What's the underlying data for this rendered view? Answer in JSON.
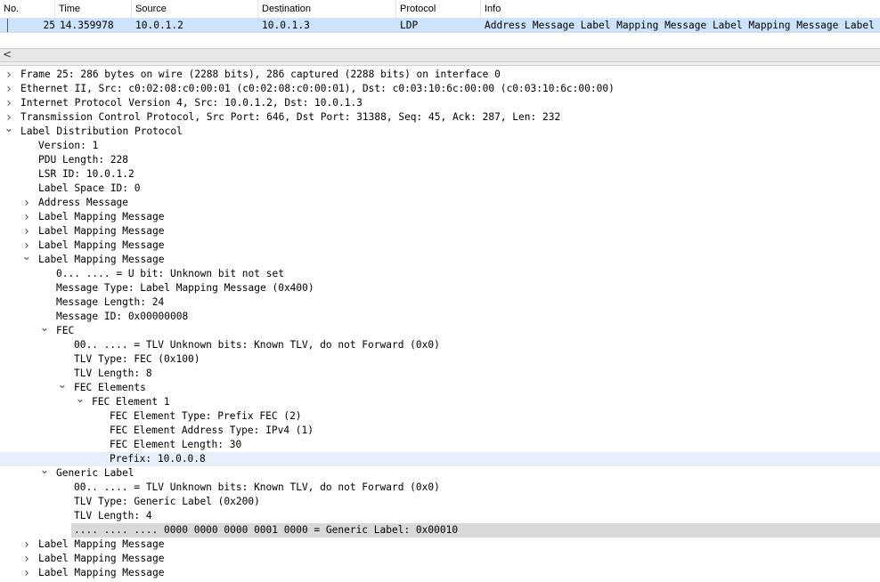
{
  "packet_list": {
    "headers": [
      "No.",
      "Time",
      "Source",
      "Destination",
      "Protocol",
      "Info"
    ],
    "row": {
      "no": "25",
      "time": "14.359978",
      "source": "10.0.1.2",
      "destination": "10.0.1.3",
      "protocol": "LDP",
      "info": "Address Message Label Mapping Message Label Mapping Message Label Mapping Message Label Mapping Message"
    }
  },
  "scroll": {
    "left_arrow": "<"
  },
  "tree": [
    {
      "text": "Frame 25: 286 bytes on wire (2288 bits), 286 captured (2288 bits) on interface 0",
      "toggle": "collapsed"
    },
    {
      "text": "Ethernet II, Src: c0:02:08:c0:00:01 (c0:02:08:c0:00:01), Dst: c0:03:10:6c:00:00 (c0:03:10:6c:00:00)",
      "toggle": "collapsed"
    },
    {
      "text": "Internet Protocol Version 4, Src: 10.0.1.2, Dst: 10.0.1.3",
      "toggle": "collapsed"
    },
    {
      "text": "Transmission Control Protocol, Src Port: 646, Dst Port: 31388, Seq: 45, Ack: 287, Len: 232",
      "toggle": "collapsed"
    },
    {
      "text": "Label Distribution Protocol",
      "toggle": "expanded"
    },
    {
      "text": "Version: 1",
      "toggle": "none"
    },
    {
      "text": "PDU Length: 228",
      "toggle": "none"
    },
    {
      "text": "LSR ID: 10.0.1.2",
      "toggle": "none"
    },
    {
      "text": "Label Space ID: 0",
      "toggle": "none"
    },
    {
      "text": "Address Message",
      "toggle": "collapsed"
    },
    {
      "text": "Label Mapping Message",
      "toggle": "collapsed"
    },
    {
      "text": "Label Mapping Message",
      "toggle": "collapsed"
    },
    {
      "text": "Label Mapping Message",
      "toggle": "collapsed"
    },
    {
      "text": "Label Mapping Message",
      "toggle": "expanded"
    },
    {
      "text": "0... .... = U bit: Unknown bit not set",
      "toggle": "none"
    },
    {
      "text": "Message Type: Label Mapping Message (0x400)",
      "toggle": "none"
    },
    {
      "text": "Message Length: 24",
      "toggle": "none"
    },
    {
      "text": "Message ID: 0x00000008",
      "toggle": "none"
    },
    {
      "text": "FEC",
      "toggle": "expanded"
    },
    {
      "text": "00.. .... = TLV Unknown bits: Known TLV, do not Forward (0x0)",
      "toggle": "none"
    },
    {
      "text": "TLV Type: FEC (0x100)",
      "toggle": "none"
    },
    {
      "text": "TLV Length: 8",
      "toggle": "none"
    },
    {
      "text": "FEC Elements",
      "toggle": "expanded"
    },
    {
      "text": "FEC Element 1",
      "toggle": "expanded"
    },
    {
      "text": "FEC Element Type: Prefix FEC (2)",
      "toggle": "none"
    },
    {
      "text": "FEC Element Address Type: IPv4 (1)",
      "toggle": "none"
    },
    {
      "text": "FEC Element Length: 30",
      "toggle": "none"
    },
    {
      "text": "Prefix: 10.0.0.8",
      "toggle": "none",
      "highlight": "light"
    },
    {
      "text": "Generic Label",
      "toggle": "expanded"
    },
    {
      "text": "00.. .... = TLV Unknown bits: Known TLV, do not Forward (0x0)",
      "toggle": "none"
    },
    {
      "text": "TLV Type: Generic Label (0x200)",
      "toggle": "none"
    },
    {
      "text": "TLV Length: 4",
      "toggle": "none"
    },
    {
      "text": ".... .... .... 0000 0000 0000 0001 0000 = Generic Label: 0x00010",
      "toggle": "none",
      "highlight": "gray"
    },
    {
      "text": "Label Mapping Message",
      "toggle": "collapsed"
    },
    {
      "text": "Label Mapping Message",
      "toggle": "collapsed"
    },
    {
      "text": "Label Mapping Message",
      "toggle": "collapsed"
    }
  ],
  "colors": {
    "selected_packet": "#cce3fb",
    "selected_field": "#e6f0fa",
    "related_field": "#d9d9d9"
  }
}
